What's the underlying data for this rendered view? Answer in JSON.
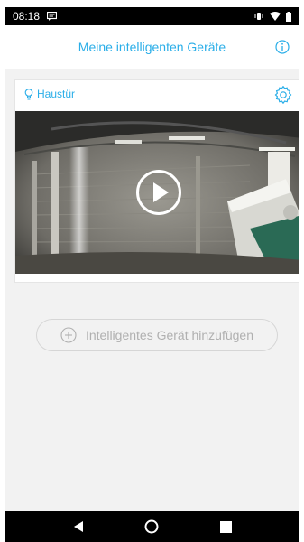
{
  "status_bar": {
    "time": "08:18",
    "icons": [
      "message-icon",
      "vibrate-icon",
      "wifi-icon",
      "battery-icon"
    ]
  },
  "header": {
    "title": "Meine intelligenten Geräte",
    "info_icon": "info-icon"
  },
  "device_card": {
    "name": "Haustür",
    "name_icon": "bulb-icon",
    "settings_icon": "gear-icon",
    "play_icon": "play-icon"
  },
  "add_device": {
    "label": "Intelligentes Gerät hinzufügen",
    "icon": "plus-circle-icon"
  },
  "nav_bar": {
    "icons": [
      "back-icon",
      "home-icon",
      "recents-icon"
    ]
  },
  "colors": {
    "accent": "#2aaee8",
    "background": "#f2f2f2",
    "status_bar": "#000000"
  }
}
